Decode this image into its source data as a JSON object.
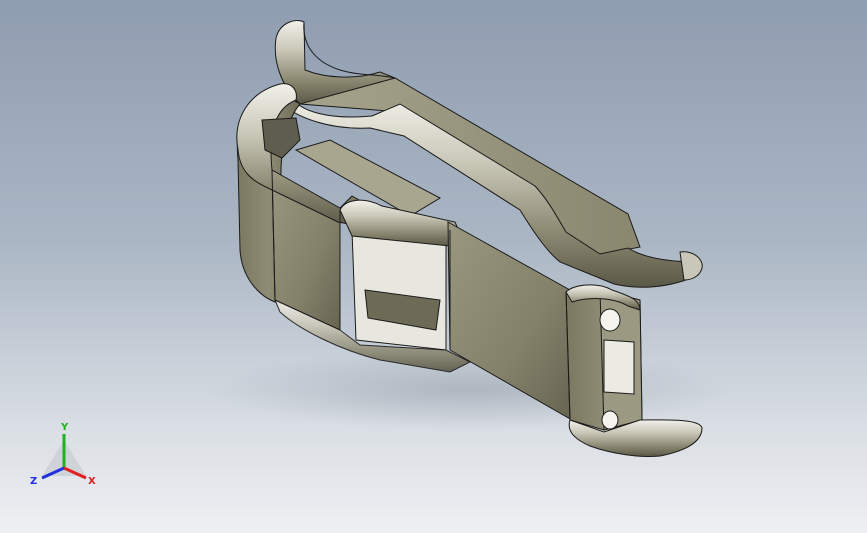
{
  "viewport": {
    "background_top": "#8f9db0",
    "background_bottom": "#eef0f2"
  },
  "model": {
    "body_color": "#8d8a73",
    "body_shadow": "#5f5d4d",
    "highlight_color": "#e4e3da",
    "edge_color": "#1a1a1a"
  },
  "triad": {
    "x_label": "X",
    "y_label": "Y",
    "z_label": "Z",
    "x_color": "#e02020",
    "y_color": "#20b020",
    "z_color": "#2030e0"
  }
}
